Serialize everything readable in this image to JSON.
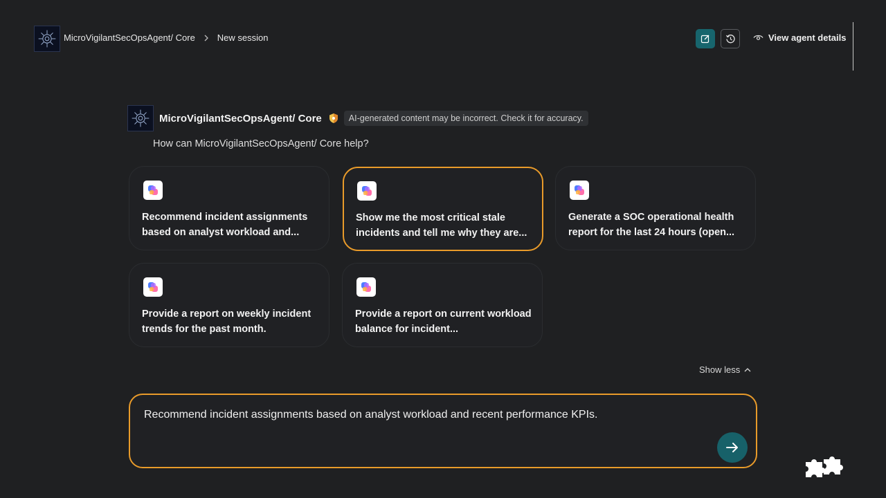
{
  "header": {
    "breadcrumb": [
      {
        "label": "MicroVigilantSecOpsAgent/ Core"
      },
      {
        "label": "New session"
      }
    ],
    "new_session_icon": "compose-icon",
    "history_icon": "history-icon",
    "view_details_label": "View agent details",
    "accent": "#17656d"
  },
  "agent": {
    "name": "MicroVigilantSecOpsAgent/ Core",
    "disclaimer": "AI-generated content may be incorrect. Check it for accuracy.",
    "help_prompt": "How can MicroVigilantSecOpsAgent/ Core help?"
  },
  "suggestions": [
    {
      "text": "Recommend incident assignments based on analyst workload and...",
      "selected": false
    },
    {
      "text": "Show me the most critical stale incidents and tell me why they are...",
      "selected": true
    },
    {
      "text": "Generate a SOC operational health report for the last 24 hours (open...",
      "selected": false
    },
    {
      "text": "Provide a report on weekly incident trends for the past month.",
      "selected": false
    },
    {
      "text": "Provide a report on current workload balance for incident...",
      "selected": false
    }
  ],
  "show_less_label": "Show less",
  "composer": {
    "value": "Recommend incident assignments based on analyst workload and recent performance KPIs.",
    "highlight_color": "#e99b2a",
    "send_icon": "arrow-right-icon"
  }
}
